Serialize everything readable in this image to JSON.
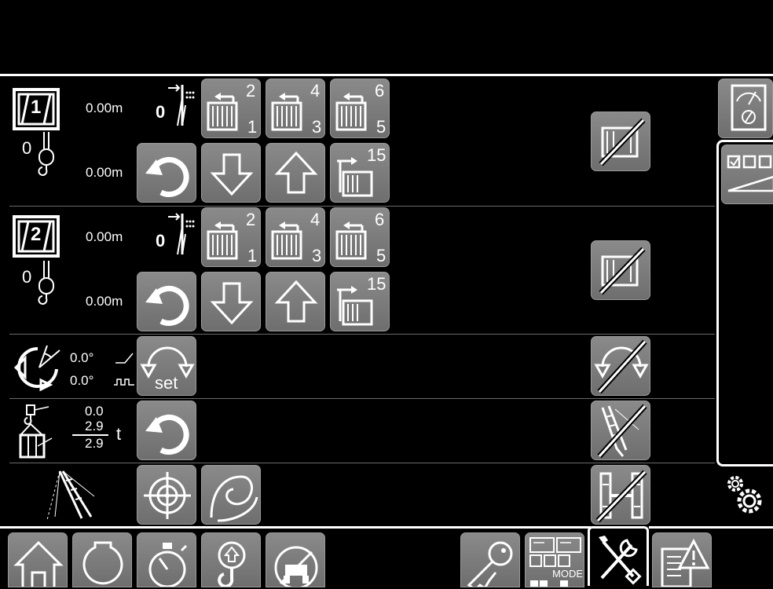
{
  "winch1": {
    "number": "1",
    "length_top": "0.00m",
    "length_bottom": "0.00m",
    "count": "0",
    "layer_count": "0",
    "reeve_a": {
      "top": "2",
      "bottom": "1"
    },
    "reeve_b": {
      "top": "4",
      "bottom": "3"
    },
    "reeve_c": {
      "top": "6",
      "bottom": "5"
    },
    "feed_label": "15"
  },
  "winch2": {
    "number": "2",
    "length_top": "0.00m",
    "length_bottom": "0.00m",
    "count": "0",
    "layer_count": "0",
    "reeve_a": {
      "top": "2",
      "bottom": "1"
    },
    "reeve_b": {
      "top": "4",
      "bottom": "3"
    },
    "reeve_c": {
      "top": "6",
      "bottom": "5"
    },
    "feed_label": "15"
  },
  "slew": {
    "angle1": "0.0°",
    "angle2": "0.0°",
    "set_label": "set"
  },
  "load": {
    "value1": "0.0",
    "value2": "2.9",
    "value3": "2.9",
    "unit": "t"
  },
  "bottom_bar": {
    "mode_label": "MODE"
  },
  "colors": {
    "button_gray": "#7a7a7a",
    "background": "#000000",
    "foreground": "#ffffff"
  },
  "icons": [
    "home-icon",
    "engine-icon",
    "stopwatch-icon",
    "hook-icon",
    "crane-disabled-icon",
    "key-icon",
    "mode-icon",
    "tools-icon",
    "warning-document-icon",
    "gear-icon",
    "meter-icon",
    "ramp-icon"
  ]
}
